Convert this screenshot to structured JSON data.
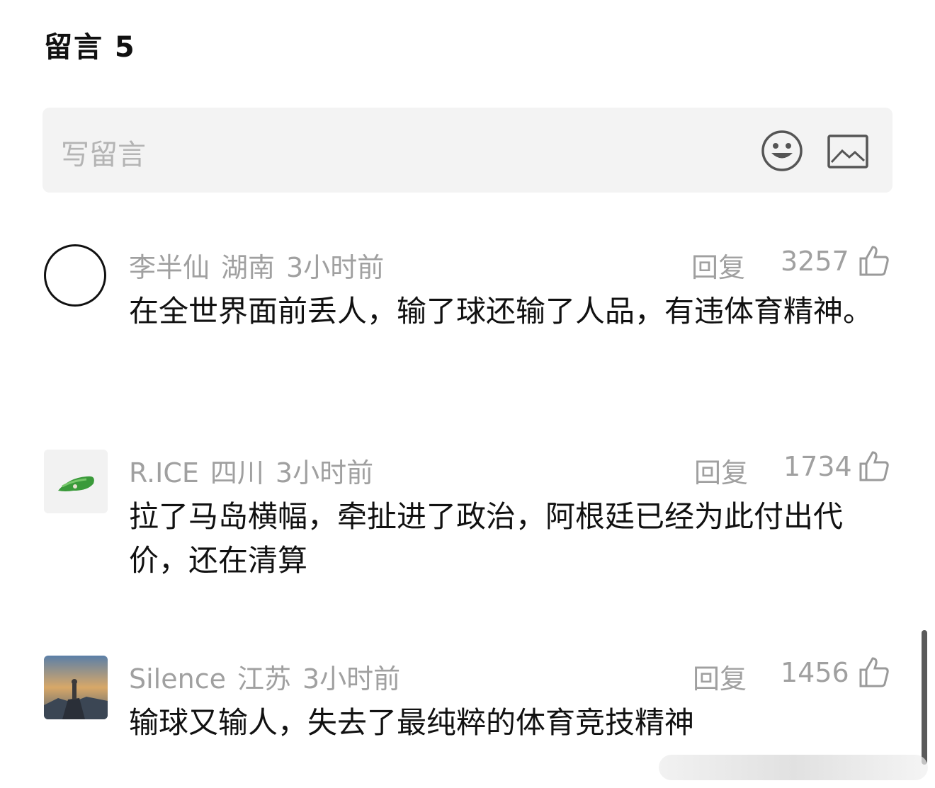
{
  "header": {
    "title": "留言 5"
  },
  "input": {
    "placeholder": "写留言",
    "emoji_icon": "smile-icon",
    "image_icon": "image-icon"
  },
  "comments": [
    {
      "user": "李半仙",
      "location": "湖南",
      "time": "3小时前",
      "reply_label": "回复",
      "likes": "3257",
      "content": "在全世界面前丢人，输了球还输了人品，有违体育精神。",
      "avatar": "empty-circle-avatar"
    },
    {
      "user": "R.ICE",
      "location": "四川",
      "time": "3小时前",
      "reply_label": "回复",
      "likes": "1734",
      "content": "拉了马岛横幅，牵扯进了政治，阿根廷已经为此付出代价，还在清算",
      "avatar": "green-fish-avatar"
    },
    {
      "user": "Silence",
      "location": "江苏",
      "time": "3小时前",
      "reply_label": "回复",
      "likes": "1456",
      "content": "输球又输人，失去了最纯粹的体育竞技精神",
      "avatar": "landscape-avatar"
    }
  ]
}
